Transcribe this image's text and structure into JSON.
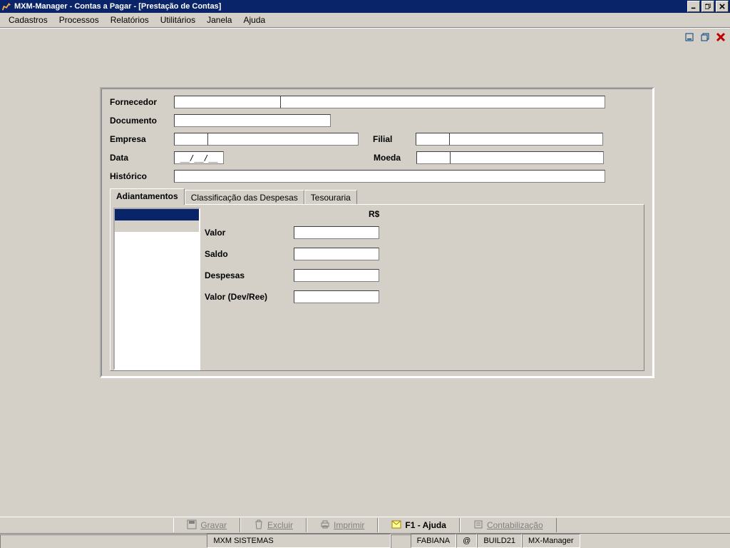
{
  "window": {
    "title": "MXM-Manager  -  Contas a Pagar - [Prestação de Contas]"
  },
  "menu": {
    "items": [
      "Cadastros",
      "Processos",
      "Relatórios",
      "Utilitários",
      "Janela",
      "Ajuda"
    ]
  },
  "form": {
    "labels": {
      "fornecedor": "Fornecedor",
      "documento": "Documento",
      "empresa": "Empresa",
      "filial": "Filial",
      "data": "Data",
      "moeda": "Moeda",
      "historico": "Histórico"
    },
    "values": {
      "fornecedor_code": "",
      "fornecedor_name": "",
      "documento": "",
      "empresa_code": "",
      "empresa_name": "",
      "filial_code": "",
      "filial_name": "",
      "data": "__/__/__",
      "moeda_code": "",
      "moeda_name": "",
      "historico": ""
    }
  },
  "tabs": {
    "items": [
      "Adiantamentos",
      "Classificação das Despesas",
      "Tesouraria"
    ],
    "active_index": 0,
    "detail": {
      "currency_header": "R$",
      "rows": {
        "valor": {
          "label": "Valor",
          "value": ""
        },
        "saldo": {
          "label": "Saldo",
          "value": ""
        },
        "despesas": {
          "label": "Despesas",
          "value": ""
        },
        "valor_devree": {
          "label": "Valor (Dev/Ree)",
          "value": ""
        }
      }
    }
  },
  "buttons": {
    "gravar": "Gravar",
    "excluir": "Excluir",
    "imprimir": "Imprimir",
    "ajuda": "F1 - Ajuda",
    "contab": "Contabilização"
  },
  "status": {
    "company": "MXM SISTEMAS",
    "user": "FABIANA",
    "at": "@",
    "build": "BUILD21",
    "app": "MX-Manager"
  }
}
